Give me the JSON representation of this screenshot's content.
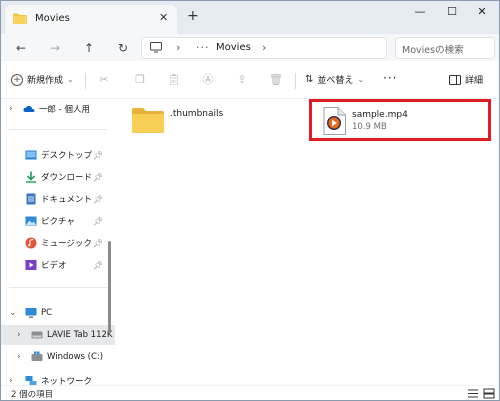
{
  "tab": {
    "title": "Movies",
    "close": "✕",
    "new": "+"
  },
  "window_controls": {
    "minimize": "—",
    "maximize": "☐",
    "close": "✕"
  },
  "nav": {
    "back": "←",
    "forward": "→",
    "up": "↑",
    "refresh": "↻"
  },
  "address": {
    "sep": "›",
    "more": "···",
    "path": "Movies"
  },
  "search": {
    "placeholder": "Moviesの検索"
  },
  "command": {
    "new_label": "新規作成",
    "new_caret": "⌄",
    "sort_label": "並べ替え",
    "sort_caret": "⌄",
    "more": "···",
    "details_label": "詳細"
  },
  "sidebar": {
    "onedrive": "一郎 - 個人用",
    "desktop": "デスクトップ",
    "downloads": "ダウンロード",
    "documents": "ドキュメント",
    "pictures": "ピクチャ",
    "music": "ミュージック",
    "videos": "ビデオ",
    "pc": "PC",
    "drive_lavie": "LAVIE Tab 112K",
    "drive_c": "Windows (C:)",
    "network": "ネットワーク"
  },
  "files": {
    "folder_name": ".thumbnails",
    "video_name": "sample.mp4",
    "video_size": "10.9 MB"
  },
  "status": {
    "count": "2 個の項目"
  },
  "colors": {
    "highlight": "#e11b22",
    "folder": "#f5c542",
    "onedrive": "#0a64c4"
  }
}
